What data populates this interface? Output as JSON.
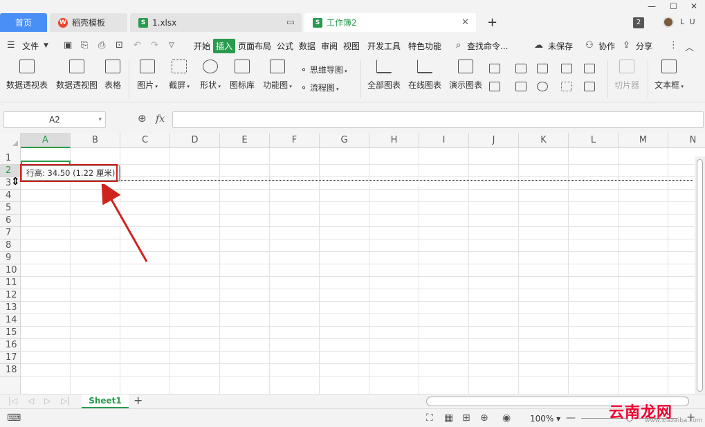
{
  "tabs": {
    "home": "首页",
    "template": "稻壳模板",
    "file1": "1.xlsx",
    "workbook": "工作簿2"
  },
  "window": {
    "badge": "2",
    "user": "L U"
  },
  "menu": {
    "file": "文件",
    "items": [
      "开始",
      "插入",
      "页面布局",
      "公式",
      "数据",
      "审阅",
      "视图",
      "开发工具",
      "特色功能"
    ],
    "active": "插入",
    "search": "查找命令...",
    "unsaved": "未保存",
    "collab": "协作",
    "share": "分享"
  },
  "ribbon": {
    "pivot_table": "数据透视表",
    "pivot_chart": "数据透视图",
    "table": "表格",
    "picture": "图片",
    "screenshot": "截屏",
    "shape": "形状",
    "icon_lib": "图标库",
    "function_chart": "功能图",
    "mindmap": "思维导图",
    "flowchart": "流程图",
    "all_charts": "全部图表",
    "online_chart": "在线图表",
    "demo_chart": "演示图表",
    "slicer": "切片器",
    "textbox": "文本框"
  },
  "formula_bar": {
    "cell_ref": "A2",
    "fx": "fx",
    "value": ""
  },
  "grid": {
    "columns": [
      "A",
      "B",
      "C",
      "D",
      "E",
      "F",
      "G",
      "H",
      "I",
      "J",
      "K",
      "L",
      "M",
      "N"
    ],
    "rows": [
      "1",
      "2",
      "3",
      "4",
      "5",
      "6",
      "7",
      "8",
      "9",
      "10",
      "11",
      "12",
      "13",
      "14",
      "15",
      "16",
      "17",
      "18"
    ],
    "selected_column": "A",
    "selected_row": "2",
    "tooltip": "行高: 34.50 (1.22 厘米)"
  },
  "sheets": {
    "active": "Sheet1"
  },
  "status": {
    "zoom": "100%"
  },
  "watermark": {
    "brand": "云南龙网",
    "url": "www.xiazaiba.com"
  },
  "colors": {
    "accent": "#2a9b4e",
    "home_tab": "#4a8ff5",
    "annotation": "#d0231e"
  }
}
